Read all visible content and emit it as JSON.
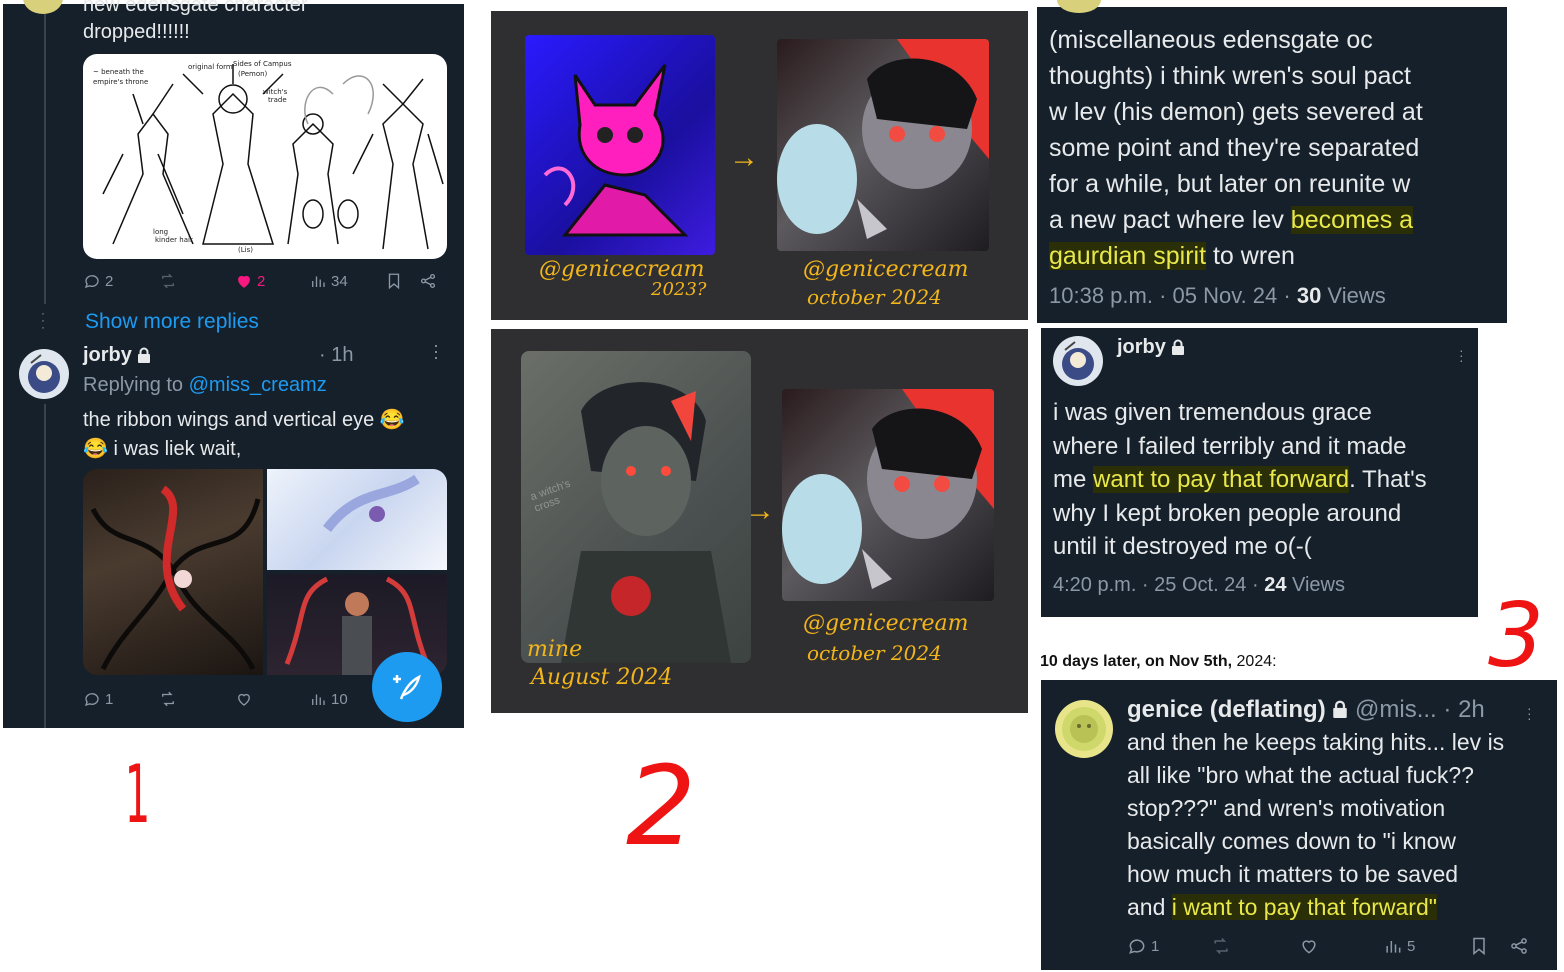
{
  "panel1": {
    "top_text_partial": "new edensgate character",
    "top_text": "dropped!!!!!!",
    "sketch_notes": [
      "original form",
      "Sides of Campus (Pemon)",
      "witch's trade",
      "long kinder hair",
      "(Lis)"
    ],
    "stats1": {
      "replies": "2",
      "likes": "2",
      "views": "34"
    },
    "show_more": "Show more replies",
    "reply": {
      "name": "jorby",
      "time": "· 1h",
      "replying_label": "Replying to",
      "replying_handle": "@miss_creamz",
      "text_line1": "the ribbon wings and vertical eye 😂",
      "text_line2": "😂 i was liek wait,"
    },
    "stats2": {
      "replies": "1",
      "views": "10"
    }
  },
  "panel2": {
    "cap1_left_a": "@genicecream",
    "cap1_left_b": "2023?",
    "cap1_right_a": "@genicecream",
    "cap1_right_b": "october 2024",
    "cap2_left_a": "mine",
    "cap2_left_b": "August 2024",
    "cap2_right_a": "@genicecream",
    "cap2_right_b": "october 2024",
    "art_tag": "a witch's cross"
  },
  "panel3a": {
    "lines": [
      "(miscellaneous edensgate oc",
      "thoughts) i think wren's soul pact",
      "w lev (his demon) gets severed at",
      "some point and they're separated",
      "for a while, but later on reunite w"
    ],
    "line6_pre": "a new pact where lev ",
    "line6_hl": "becomes a",
    "line7_hl": "gaurdian spirit",
    "line7_post": " to wren",
    "meta_time": "10:38 p.m. · 05 Nov. 24 · ",
    "meta_views_num": "30",
    "meta_views_label": " Views"
  },
  "panel3b": {
    "name": "jorby",
    "line1": "i was given tremendous grace",
    "line2": "where I failed terribly and it made",
    "line3_pre": "me ",
    "line3_hl": "want to pay that forward",
    "line3_post": ". That's",
    "line4": "why I kept broken people around",
    "line5": "until it destroyed me o(-(",
    "meta_time": "4:20 p.m. · 25 Oct. 24 · ",
    "meta_views_num": "24",
    "meta_views_label": " Views"
  },
  "caption": {
    "bold": "10 days later, on Nov 5th,",
    "rest": " 2024:"
  },
  "panel3c": {
    "name": "genice (deflating)",
    "handle": "@mis...",
    "time": "· 2h",
    "lines": [
      "and then he keeps taking hits... lev is",
      "all like \"bro what the actual fuck??",
      "stop???\" and wren's motivation",
      "basically comes down to \"i know",
      "how much it matters to be saved"
    ],
    "last_pre": "and ",
    "last_hl": "i want to pay that forward\"",
    "stats": {
      "replies": "1",
      "views": "5"
    }
  },
  "annotations": {
    "one": "1",
    "two": "2",
    "three": "3"
  },
  "colors": {
    "panel_bg": "#15202b",
    "accent_blue": "#1d9bf0",
    "highlight": "#e9e84a",
    "like_pink": "#f91880",
    "annotation_red": "#ef1414",
    "caption_yellow": "#f2b51a"
  },
  "icons": [
    "reply-icon",
    "retweet-icon",
    "heart-icon",
    "views-icon",
    "bookmark-icon",
    "share-icon",
    "lock-icon",
    "more-icon",
    "compose-icon",
    "arrow-right-icon"
  ]
}
